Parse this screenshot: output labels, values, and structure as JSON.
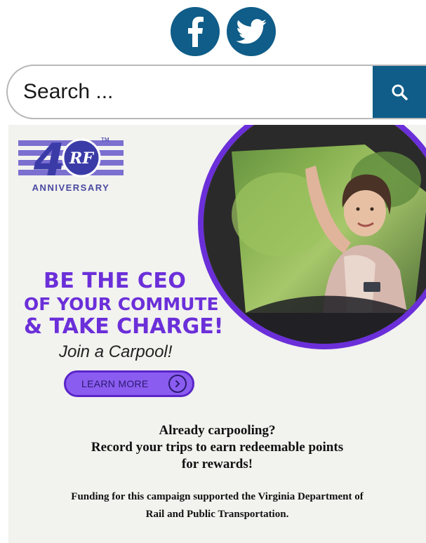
{
  "social": {
    "items": [
      {
        "icon": "facebook-icon",
        "color": "#0f5d88"
      },
      {
        "icon": "twitter-icon",
        "color": "#0f5d88"
      }
    ]
  },
  "search": {
    "placeholder": "Search ...",
    "value": "",
    "button_icon": "search-icon",
    "button_color": "#0f5d88"
  },
  "banner": {
    "anniversary": {
      "number": "40",
      "mark": "TM",
      "label": "ANNIVERSARY",
      "logo_text": "RF"
    },
    "headline": {
      "line1": "BE THE CEO",
      "line2": "OF YOUR COMMUTE",
      "line3": "& TAKE CHARGE!"
    },
    "subheadline": "Join a Carpool!",
    "cta_label": "LEARN MORE",
    "cta_icon": "chevron-right-icon",
    "accent_color": "#6b2fd9",
    "already_line1": "Already carpooling?",
    "already_line2": "Record your trips to earn redeemable points",
    "already_line3": "for rewards!",
    "funding_line1": "Funding for this campaign supported the Virginia Department of",
    "funding_line2": "Rail and Public Transportation."
  }
}
